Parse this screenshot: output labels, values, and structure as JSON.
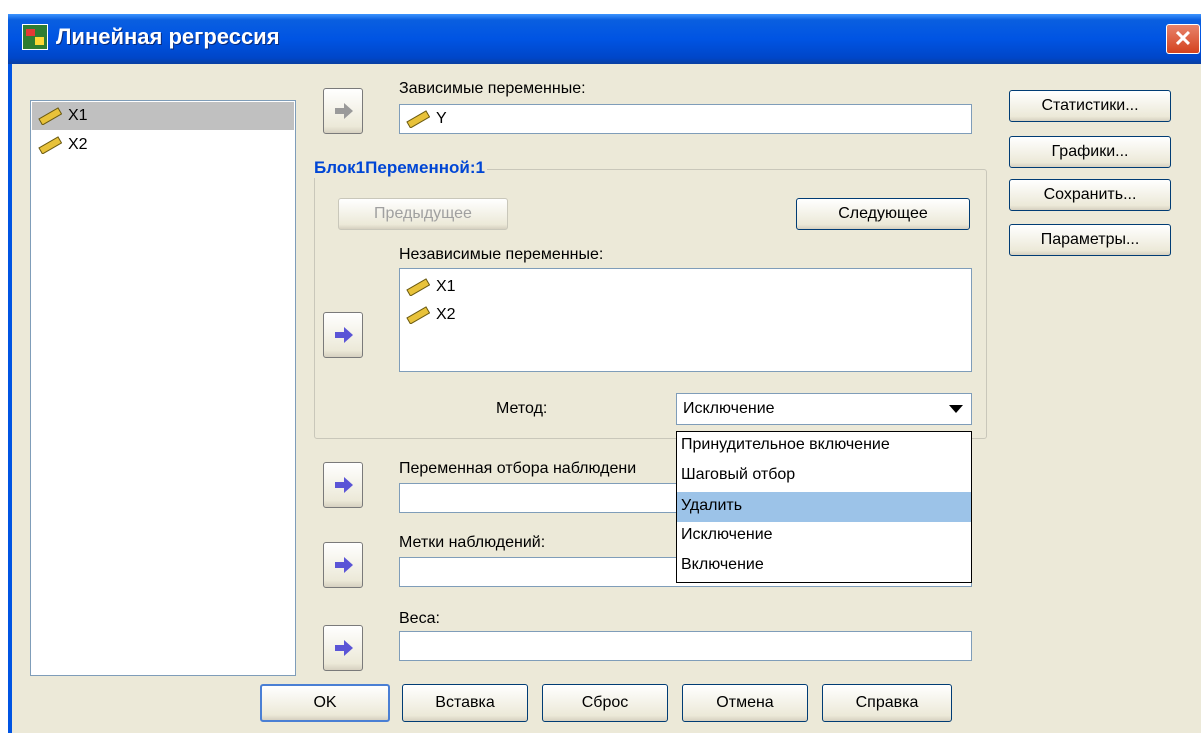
{
  "window": {
    "title": "Линейная регрессия",
    "close_glyph": "✕"
  },
  "source_list": {
    "items": [
      "X1",
      "X2"
    ]
  },
  "dependent": {
    "label": "Зависимые переменные:",
    "value": "Y"
  },
  "block": {
    "title": "Блок1Переменной:1",
    "prev_label": "Предыдущее",
    "next_label": "Следующее",
    "independent_label": "Независимые переменные:",
    "independent_items": [
      "X1",
      "X2"
    ],
    "method_label": "Метод:",
    "method_value": "Исключение",
    "method_options": [
      "Принудительное включение",
      "Шаговый отбор",
      "Удалить",
      "Исключение",
      "Включение"
    ],
    "highlighted_option": "Удалить"
  },
  "selection_var": {
    "label": "Переменная отбора наблюдени"
  },
  "case_labels": {
    "label": "Метки наблюдений:"
  },
  "weights": {
    "label": "Веса:"
  },
  "side_buttons": [
    "Статистики...",
    "Графики...",
    "Сохранить...",
    "Параметры..."
  ],
  "bottom_buttons": [
    "OK",
    "Вставка",
    "Сброс",
    "Отмена",
    "Справка"
  ],
  "colors": {
    "titlebar": "#0054e3",
    "dialog_bg": "#ece9d8",
    "highlight": "#9cc3e8",
    "group_title": "#0046d5",
    "arrow": "#5b55d6"
  },
  "icons": {
    "variable": "ruler-icon",
    "move": "arrow-right-icon",
    "dropdown": "chevron-down-icon"
  }
}
